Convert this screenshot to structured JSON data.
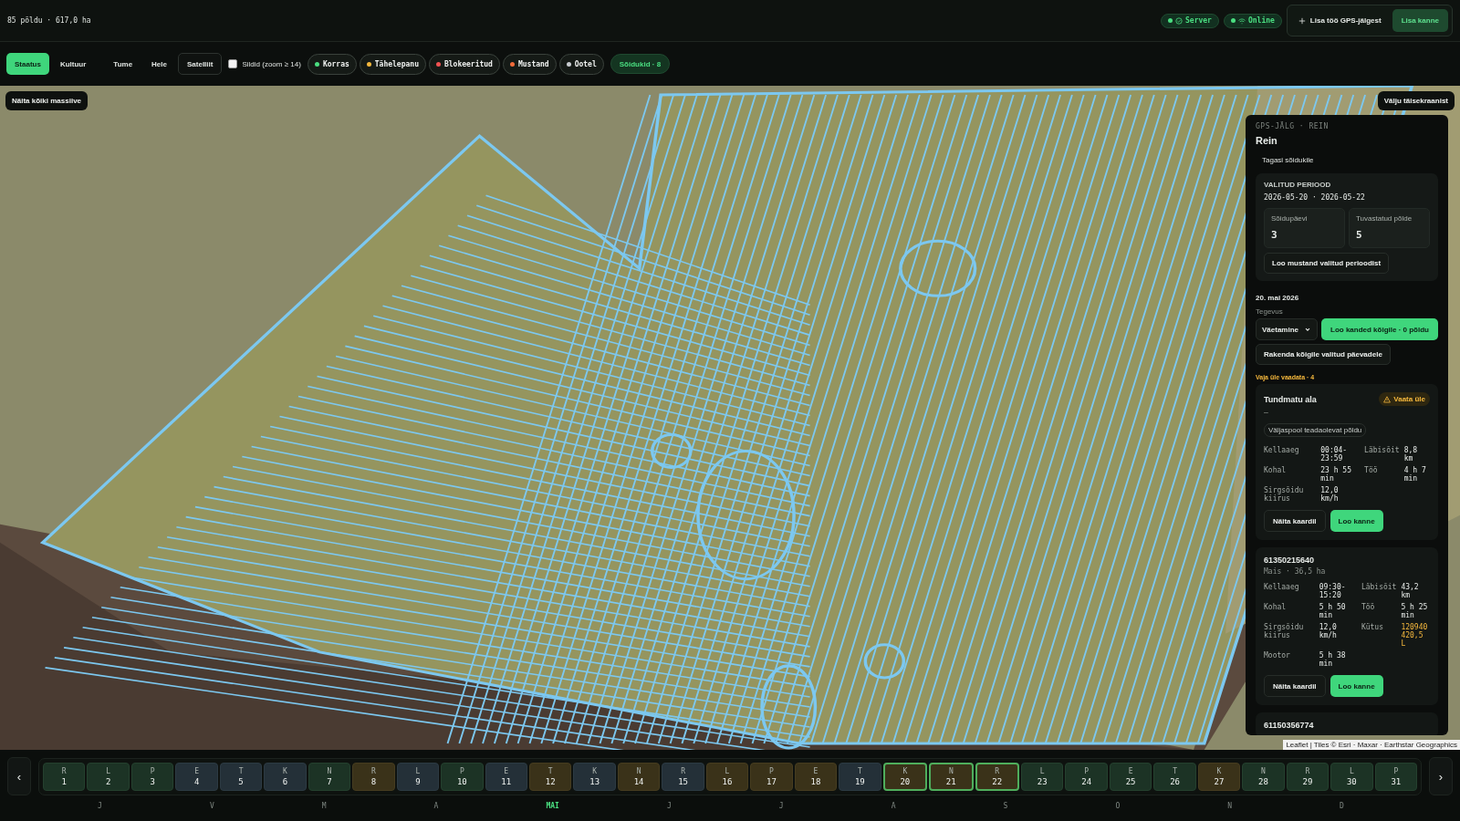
{
  "header": {
    "summary": "85 põldu · 617,0 ha",
    "status": [
      {
        "label": "Server",
        "on": true
      },
      {
        "label": "Online",
        "on": true
      }
    ],
    "gps_button": "Lisa töö GPS-jälgest",
    "add_button": "Lisa kanne"
  },
  "toolbar": {
    "modes": [
      {
        "label": "Staatus",
        "selected": true
      },
      {
        "label": "Kultuur",
        "selected": false
      }
    ],
    "basemaps": [
      {
        "label": "Tume",
        "selected": false
      },
      {
        "label": "Hele",
        "selected": false
      },
      {
        "label": "Satelliit",
        "selected": true
      }
    ],
    "labels_toggle": {
      "label": "Sildid (zoom ≥ 14)",
      "checked": false
    },
    "filters": [
      {
        "label": "Korras",
        "color": "#4ade80"
      },
      {
        "label": "Tähelepanu",
        "color": "#f5b83d"
      },
      {
        "label": "Blokeeritud",
        "color": "#f05252"
      },
      {
        "label": "Mustand",
        "color": "#f26b3a"
      },
      {
        "label": "Ootel",
        "color": "#c8ccd0"
      }
    ],
    "vehicles": "Sõidukid · 8"
  },
  "map": {
    "show_all": "Näita kõiki massiive",
    "exit_fullscreen": "Välju täisekraanist",
    "attribution": "Leaflet | Tiles © Esri · Maxar · Earthstar Geographics"
  },
  "panel": {
    "eyebrow": "GPS-JÄLG · REIN",
    "title": "Rein",
    "back": "Tagasi sõidukile",
    "period": {
      "label": "VALITUD PERIOOD",
      "range": "2026-05-20 · 2026-05-22",
      "stats": [
        {
          "label": "Sõidupäevi",
          "value": "3"
        },
        {
          "label": "Tuvastatud põlde",
          "value": "5"
        }
      ],
      "draft_button": "Loo mustand valitud perioodist"
    },
    "day": "20. mai 2026",
    "activity_label": "Tegevus",
    "activity": "Väetamine",
    "create_all": "Loo kanded kõigile · 0 põldu",
    "apply_all": "Rakenda kõigile valitud päevadele",
    "review_heading": "Vaja üle vaadata · 4",
    "cards": [
      {
        "title": "Tundmatu ala",
        "subtitle": "–",
        "badge": "Vaata üle",
        "tag": "Väljaspool teadaolevat põldu",
        "stats": [
          {
            "label": "Kellaaeg",
            "value": "00:04-23:59",
            "warn": false
          },
          {
            "label": "Läbisõit",
            "value": "8,8 km",
            "warn": false
          },
          {
            "label": "Kohal",
            "value": "23 h 55 min",
            "warn": false
          },
          {
            "label": "Töö",
            "value": "4 h 7 min",
            "warn": false
          },
          {
            "label": "Sirgsõidu kiirus",
            "value": "12,0 km/h",
            "warn": false
          }
        ],
        "buttons": [
          "Näita kaardil",
          "Loo kanne"
        ]
      },
      {
        "title": "61350215640",
        "subtitle": "Mais · 36,5 ha",
        "stats": [
          {
            "label": "Kellaaeg",
            "value": "09:30-15:20",
            "warn": false
          },
          {
            "label": "Läbisõit",
            "value": "43,2 km",
            "warn": false
          },
          {
            "label": "Kohal",
            "value": "5 h 50 min",
            "warn": false
          },
          {
            "label": "Töö",
            "value": "5 h 25 min",
            "warn": false
          },
          {
            "label": "Sirgsõidu kiirus",
            "value": "12,0 km/h",
            "warn": false
          },
          {
            "label": "Kütus",
            "value": "120940420,5 L",
            "warn": true
          },
          {
            "label": "Mootor",
            "value": "5 h 38 min",
            "warn": false
          }
        ],
        "buttons": [
          "Näita kaardil",
          "Loo kanne"
        ]
      },
      {
        "title": "61150356774"
      }
    ]
  },
  "calendar": {
    "prev": "‹",
    "next": "›",
    "days": [
      {
        "weekday": "R",
        "day": "1",
        "kind": "worked",
        "selected": false
      },
      {
        "weekday": "L",
        "day": "2",
        "kind": "worked",
        "selected": false
      },
      {
        "weekday": "P",
        "day": "3",
        "kind": "worked",
        "selected": false
      },
      {
        "weekday": "E",
        "day": "4",
        "kind": "idle",
        "selected": false
      },
      {
        "weekday": "T",
        "day": "5",
        "kind": "idle",
        "selected": false
      },
      {
        "weekday": "K",
        "day": "6",
        "kind": "idle",
        "selected": false
      },
      {
        "weekday": "N",
        "day": "7",
        "kind": "worked",
        "selected": false
      },
      {
        "weekday": "R",
        "day": "8",
        "kind": "draft",
        "selected": false
      },
      {
        "weekday": "L",
        "day": "9",
        "kind": "idle",
        "selected": false
      },
      {
        "weekday": "P",
        "day": "10",
        "kind": "worked",
        "selected": false
      },
      {
        "weekday": "E",
        "day": "11",
        "kind": "idle",
        "selected": false
      },
      {
        "weekday": "T",
        "day": "12",
        "kind": "draft",
        "selected": false
      },
      {
        "weekday": "K",
        "day": "13",
        "kind": "idle",
        "selected": false
      },
      {
        "weekday": "N",
        "day": "14",
        "kind": "draft",
        "selected": false
      },
      {
        "weekday": "R",
        "day": "15",
        "kind": "idle",
        "selected": false
      },
      {
        "weekday": "L",
        "day": "16",
        "kind": "draft",
        "selected": false
      },
      {
        "weekday": "P",
        "day": "17",
        "kind": "draft",
        "selected": false
      },
      {
        "weekday": "E",
        "day": "18",
        "kind": "draft",
        "selected": false
      },
      {
        "weekday": "T",
        "day": "19",
        "kind": "idle",
        "selected": false
      },
      {
        "weekday": "K",
        "day": "20",
        "kind": "draft",
        "selected": true
      },
      {
        "weekday": "N",
        "day": "21",
        "kind": "draft",
        "selected": true
      },
      {
        "weekday": "R",
        "day": "22",
        "kind": "draft",
        "selected": true
      },
      {
        "weekday": "L",
        "day": "23",
        "kind": "worked",
        "selected": false
      },
      {
        "weekday": "P",
        "day": "24",
        "kind": "worked",
        "selected": false
      },
      {
        "weekday": "E",
        "day": "25",
        "kind": "worked",
        "selected": false
      },
      {
        "weekday": "T",
        "day": "26",
        "kind": "worked",
        "selected": false
      },
      {
        "weekday": "K",
        "day": "27",
        "kind": "draft",
        "selected": false
      },
      {
        "weekday": "N",
        "day": "28",
        "kind": "worked",
        "selected": false
      },
      {
        "weekday": "R",
        "day": "29",
        "kind": "worked",
        "selected": false
      },
      {
        "weekday": "L",
        "day": "30",
        "kind": "worked",
        "selected": false
      },
      {
        "weekday": "P",
        "day": "31",
        "kind": "worked",
        "selected": false
      }
    ],
    "months": [
      {
        "label": "J",
        "selected": false
      },
      {
        "label": "V",
        "selected": false
      },
      {
        "label": "M",
        "selected": false
      },
      {
        "label": "A",
        "selected": false
      },
      {
        "label": "MAI",
        "selected": true
      },
      {
        "label": "J",
        "selected": false
      },
      {
        "label": "J",
        "selected": false
      },
      {
        "label": "A",
        "selected": false
      },
      {
        "label": "S",
        "selected": false
      },
      {
        "label": "O",
        "selected": false
      },
      {
        "label": "N",
        "selected": false
      },
      {
        "label": "D",
        "selected": false
      }
    ]
  }
}
